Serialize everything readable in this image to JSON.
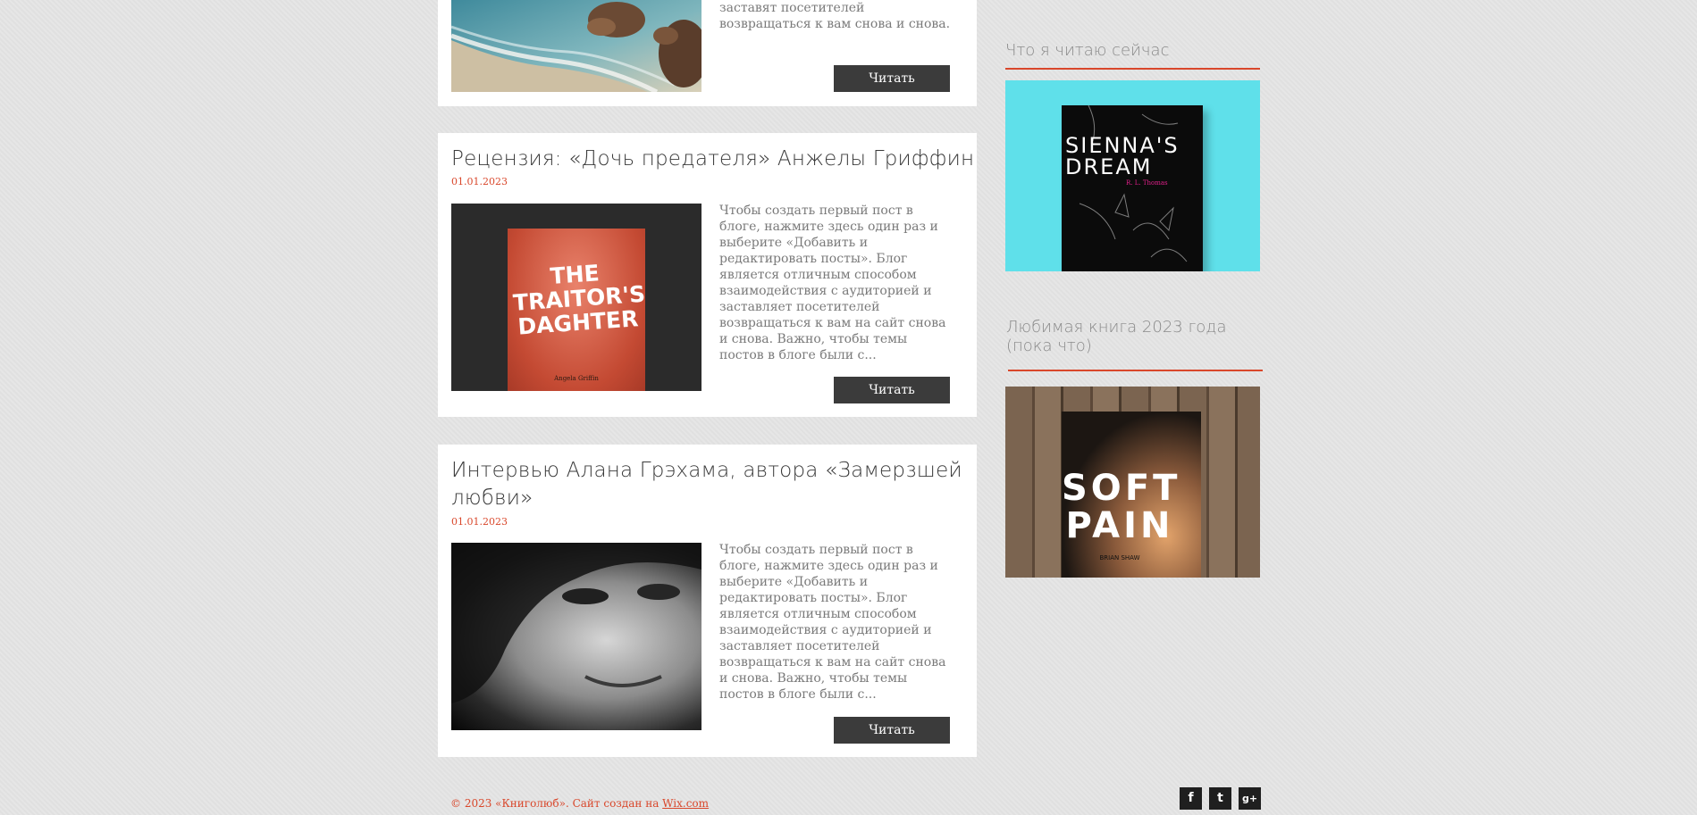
{
  "posts": [
    {
      "excerpt_tail": "заставят посетителей возвращаться к вам снова и снова.",
      "read_label": "Читать",
      "image": "beach-coast-photo"
    },
    {
      "title": "Рецензия: «Дочь предателя» Анжелы Гриффин",
      "date": "01.01.2023",
      "excerpt": "Чтобы создать первый пост в блоге, нажмите здесь один раз и выберите «Добавить и редактировать посты». Блог является отличным способом взаимодействия с аудиторией и заставляет посетителей возвращаться к вам на сайт снова и снова. Важно, чтобы темы постов в блоге были с...",
      "read_label": "Читать",
      "cover": {
        "title": "THE TRAITOR'S DAGHTER",
        "author": "Angela Griffin"
      }
    },
    {
      "title": "Интервью Алана Грэхама, автора «Замерзшей любви»",
      "date": "01.01.2023",
      "excerpt": "Чтобы создать первый пост в блоге, нажмите здесь один раз и выберите «Добавить и редактировать посты». Блог является отличным способом взаимодействия с аудиторией и заставляет посетителей возвращаться к вам на сайт снова и снова. Важно, чтобы темы постов в блоге были с...",
      "read_label": "Читать",
      "image": "author-portrait-photo"
    }
  ],
  "sidebar": {
    "now_reading": {
      "title": "Что я читаю сейчас",
      "book": {
        "title_line1": "SIENNA'S",
        "title_line2": "DREAM",
        "author": "R. L. Thomas"
      }
    },
    "favorite": {
      "title": "Любимая книга 2023 года (пока что)",
      "book": {
        "title_line1": "SOFT",
        "title_line2": "PAIN",
        "author": "BRIAN SHAW"
      }
    }
  },
  "footer": {
    "copyright": "© 2023 «Книголюб». Сайт создан на ",
    "link": "Wix.com"
  },
  "social": {
    "facebook": "f",
    "twitter": "t",
    "google": "g+"
  },
  "colors": {
    "accent": "#d9472b",
    "button": "#3b3b3b",
    "background": "#e4e4e4"
  }
}
